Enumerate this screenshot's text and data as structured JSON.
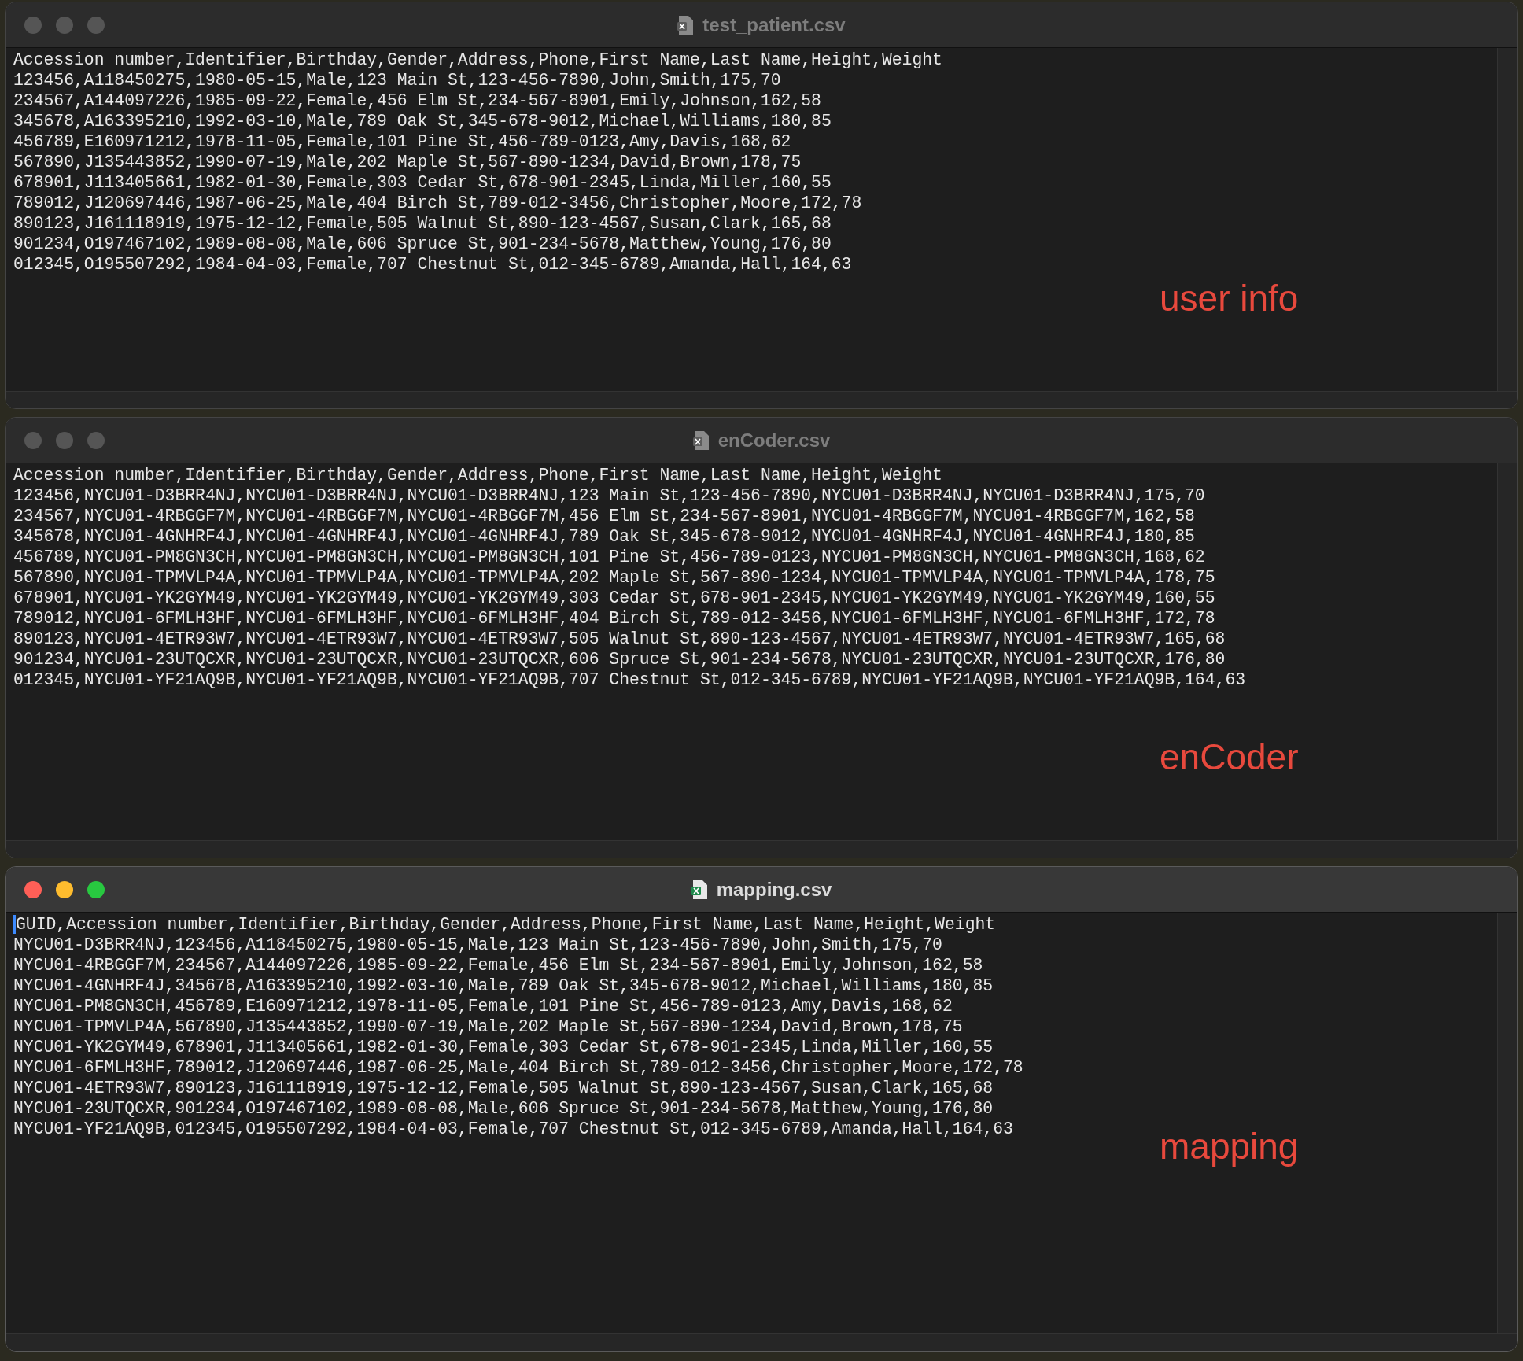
{
  "windows": [
    {
      "title": "test_patient.csv",
      "active": false,
      "cursor": false,
      "annotation": "user info",
      "lines": [
        "Accession number,Identifier,Birthday,Gender,Address,Phone,First Name,Last Name,Height,Weight",
        "123456,A118450275,1980-05-15,Male,123 Main St,123-456-7890,John,Smith,175,70",
        "234567,A144097226,1985-09-22,Female,456 Elm St,234-567-8901,Emily,Johnson,162,58",
        "345678,A163395210,1992-03-10,Male,789 Oak St,345-678-9012,Michael,Williams,180,85",
        "456789,E160971212,1978-11-05,Female,101 Pine St,456-789-0123,Amy,Davis,168,62",
        "567890,J135443852,1990-07-19,Male,202 Maple St,567-890-1234,David,Brown,178,75",
        "678901,J113405661,1982-01-30,Female,303 Cedar St,678-901-2345,Linda,Miller,160,55",
        "789012,J120697446,1987-06-25,Male,404 Birch St,789-012-3456,Christopher,Moore,172,78",
        "890123,J161118919,1975-12-12,Female,505 Walnut St,890-123-4567,Susan,Clark,165,68",
        "901234,O197467102,1989-08-08,Male,606 Spruce St,901-234-5678,Matthew,Young,176,80",
        "012345,O195507292,1984-04-03,Female,707 Chestnut St,012-345-6789,Amanda,Hall,164,63"
      ]
    },
    {
      "title": "enCoder.csv",
      "active": false,
      "cursor": false,
      "annotation": "enCoder",
      "lines": [
        "Accession number,Identifier,Birthday,Gender,Address,Phone,First Name,Last Name,Height,Weight",
        "123456,NYCU01-D3BRR4NJ,NYCU01-D3BRR4NJ,NYCU01-D3BRR4NJ,123 Main St,123-456-7890,NYCU01-D3BRR4NJ,NYCU01-D3BRR4NJ,175,70",
        "234567,NYCU01-4RBGGF7M,NYCU01-4RBGGF7M,NYCU01-4RBGGF7M,456 Elm St,234-567-8901,NYCU01-4RBGGF7M,NYCU01-4RBGGF7M,162,58",
        "345678,NYCU01-4GNHRF4J,NYCU01-4GNHRF4J,NYCU01-4GNHRF4J,789 Oak St,345-678-9012,NYCU01-4GNHRF4J,NYCU01-4GNHRF4J,180,85",
        "456789,NYCU01-PM8GN3CH,NYCU01-PM8GN3CH,NYCU01-PM8GN3CH,101 Pine St,456-789-0123,NYCU01-PM8GN3CH,NYCU01-PM8GN3CH,168,62",
        "567890,NYCU01-TPMVLP4A,NYCU01-TPMVLP4A,NYCU01-TPMVLP4A,202 Maple St,567-890-1234,NYCU01-TPMVLP4A,NYCU01-TPMVLP4A,178,75",
        "678901,NYCU01-YK2GYM49,NYCU01-YK2GYM49,NYCU01-YK2GYM49,303 Cedar St,678-901-2345,NYCU01-YK2GYM49,NYCU01-YK2GYM49,160,55",
        "789012,NYCU01-6FMLH3HF,NYCU01-6FMLH3HF,NYCU01-6FMLH3HF,404 Birch St,789-012-3456,NYCU01-6FMLH3HF,NYCU01-6FMLH3HF,172,78",
        "890123,NYCU01-4ETR93W7,NYCU01-4ETR93W7,NYCU01-4ETR93W7,505 Walnut St,890-123-4567,NYCU01-4ETR93W7,NYCU01-4ETR93W7,165,68",
        "901234,NYCU01-23UTQCXR,NYCU01-23UTQCXR,NYCU01-23UTQCXR,606 Spruce St,901-234-5678,NYCU01-23UTQCXR,NYCU01-23UTQCXR,176,80",
        "012345,NYCU01-YF21AQ9B,NYCU01-YF21AQ9B,NYCU01-YF21AQ9B,707 Chestnut St,012-345-6789,NYCU01-YF21AQ9B,NYCU01-YF21AQ9B,164,63"
      ]
    },
    {
      "title": "mapping.csv",
      "active": true,
      "cursor": true,
      "annotation": "mapping",
      "lines": [
        "GUID,Accession number,Identifier,Birthday,Gender,Address,Phone,First Name,Last Name,Height,Weight",
        "NYCU01-D3BRR4NJ,123456,A118450275,1980-05-15,Male,123 Main St,123-456-7890,John,Smith,175,70",
        "NYCU01-4RBGGF7M,234567,A144097226,1985-09-22,Female,456 Elm St,234-567-8901,Emily,Johnson,162,58",
        "NYCU01-4GNHRF4J,345678,A163395210,1992-03-10,Male,789 Oak St,345-678-9012,Michael,Williams,180,85",
        "NYCU01-PM8GN3CH,456789,E160971212,1978-11-05,Female,101 Pine St,456-789-0123,Amy,Davis,168,62",
        "NYCU01-TPMVLP4A,567890,J135443852,1990-07-19,Male,202 Maple St,567-890-1234,David,Brown,178,75",
        "NYCU01-YK2GYM49,678901,J113405661,1982-01-30,Female,303 Cedar St,678-901-2345,Linda,Miller,160,55",
        "NYCU01-6FMLH3HF,789012,J120697446,1987-06-25,Male,404 Birch St,789-012-3456,Christopher,Moore,172,78",
        "NYCU01-4ETR93W7,890123,J161118919,1975-12-12,Female,505 Walnut St,890-123-4567,Susan,Clark,165,68",
        "NYCU01-23UTQCXR,901234,O197467102,1989-08-08,Male,606 Spruce St,901-234-5678,Matthew,Young,176,80",
        "NYCU01-YF21AQ9B,012345,O195507292,1984-04-03,Female,707 Chestnut St,012-345-6789,Amanda,Hall,164,63"
      ]
    }
  ]
}
